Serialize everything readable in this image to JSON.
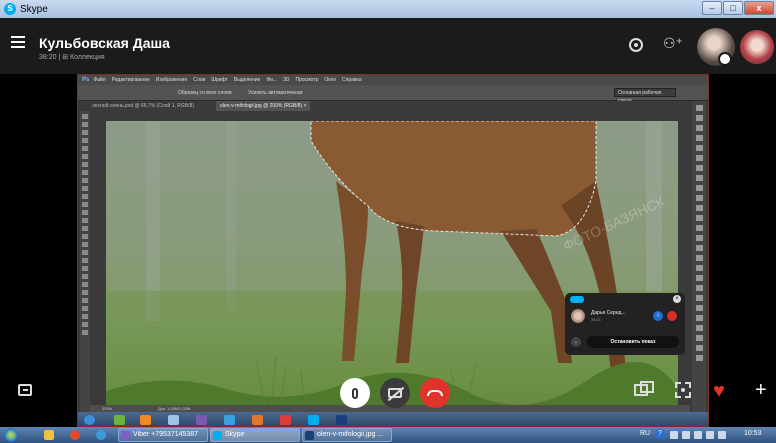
{
  "window": {
    "title": "Skype",
    "controls": [
      "–",
      "□",
      "x"
    ]
  },
  "header": {
    "contact_name": "Кульбовская Даша",
    "subtitle": "38:20 | ⊞ Коллекция"
  },
  "screen_share": {
    "ps_logo": "Ps",
    "ps_menu": [
      "Файл",
      "Редактирование",
      "Изображение",
      "Слои",
      "Шрифт",
      "Выделение",
      "Фи...",
      "3D",
      "Просмотр",
      "Окно",
      "Справка"
    ],
    "options": {
      "sample_all_layers": "Образец со всех слоев",
      "auto_enhance": "Усилить автоматически",
      "workspace": "Основная рабочая среда"
    },
    "tabs": {
      "inactive": "лесной олень.psd @ 66,7% (Слой 1, RGB/8)",
      "active": "olen-v-mifologii.jpg @ 200% (RGB/8) ×"
    },
    "status_zoom": "200%",
    "status_doc": "Док: 1,03M/1,03M",
    "watermark": "ФОТО-БАЗЯНСК"
  },
  "popup": {
    "caller_name": "Дарья Серед...",
    "caller_time": "38:21",
    "info_label": "i",
    "stop_sharing": "Остановить показ",
    "close": "×"
  },
  "call_controls": {
    "heart": "♥",
    "plus": "+"
  },
  "taskbar": {
    "tasks": [
      {
        "label": "Viber +79537145387",
        "active": false
      },
      {
        "label": "Skype",
        "active": true
      },
      {
        "label": "olen-v-mifologii.jpg ...",
        "active": false
      }
    ],
    "lang": "RU",
    "help": "?",
    "time": "10:53"
  },
  "colors": {
    "end_call": "#e0342b",
    "skype_blue": "#00aff0",
    "header_bg": "#1b1b1b",
    "taskbar": "#2f517d"
  }
}
